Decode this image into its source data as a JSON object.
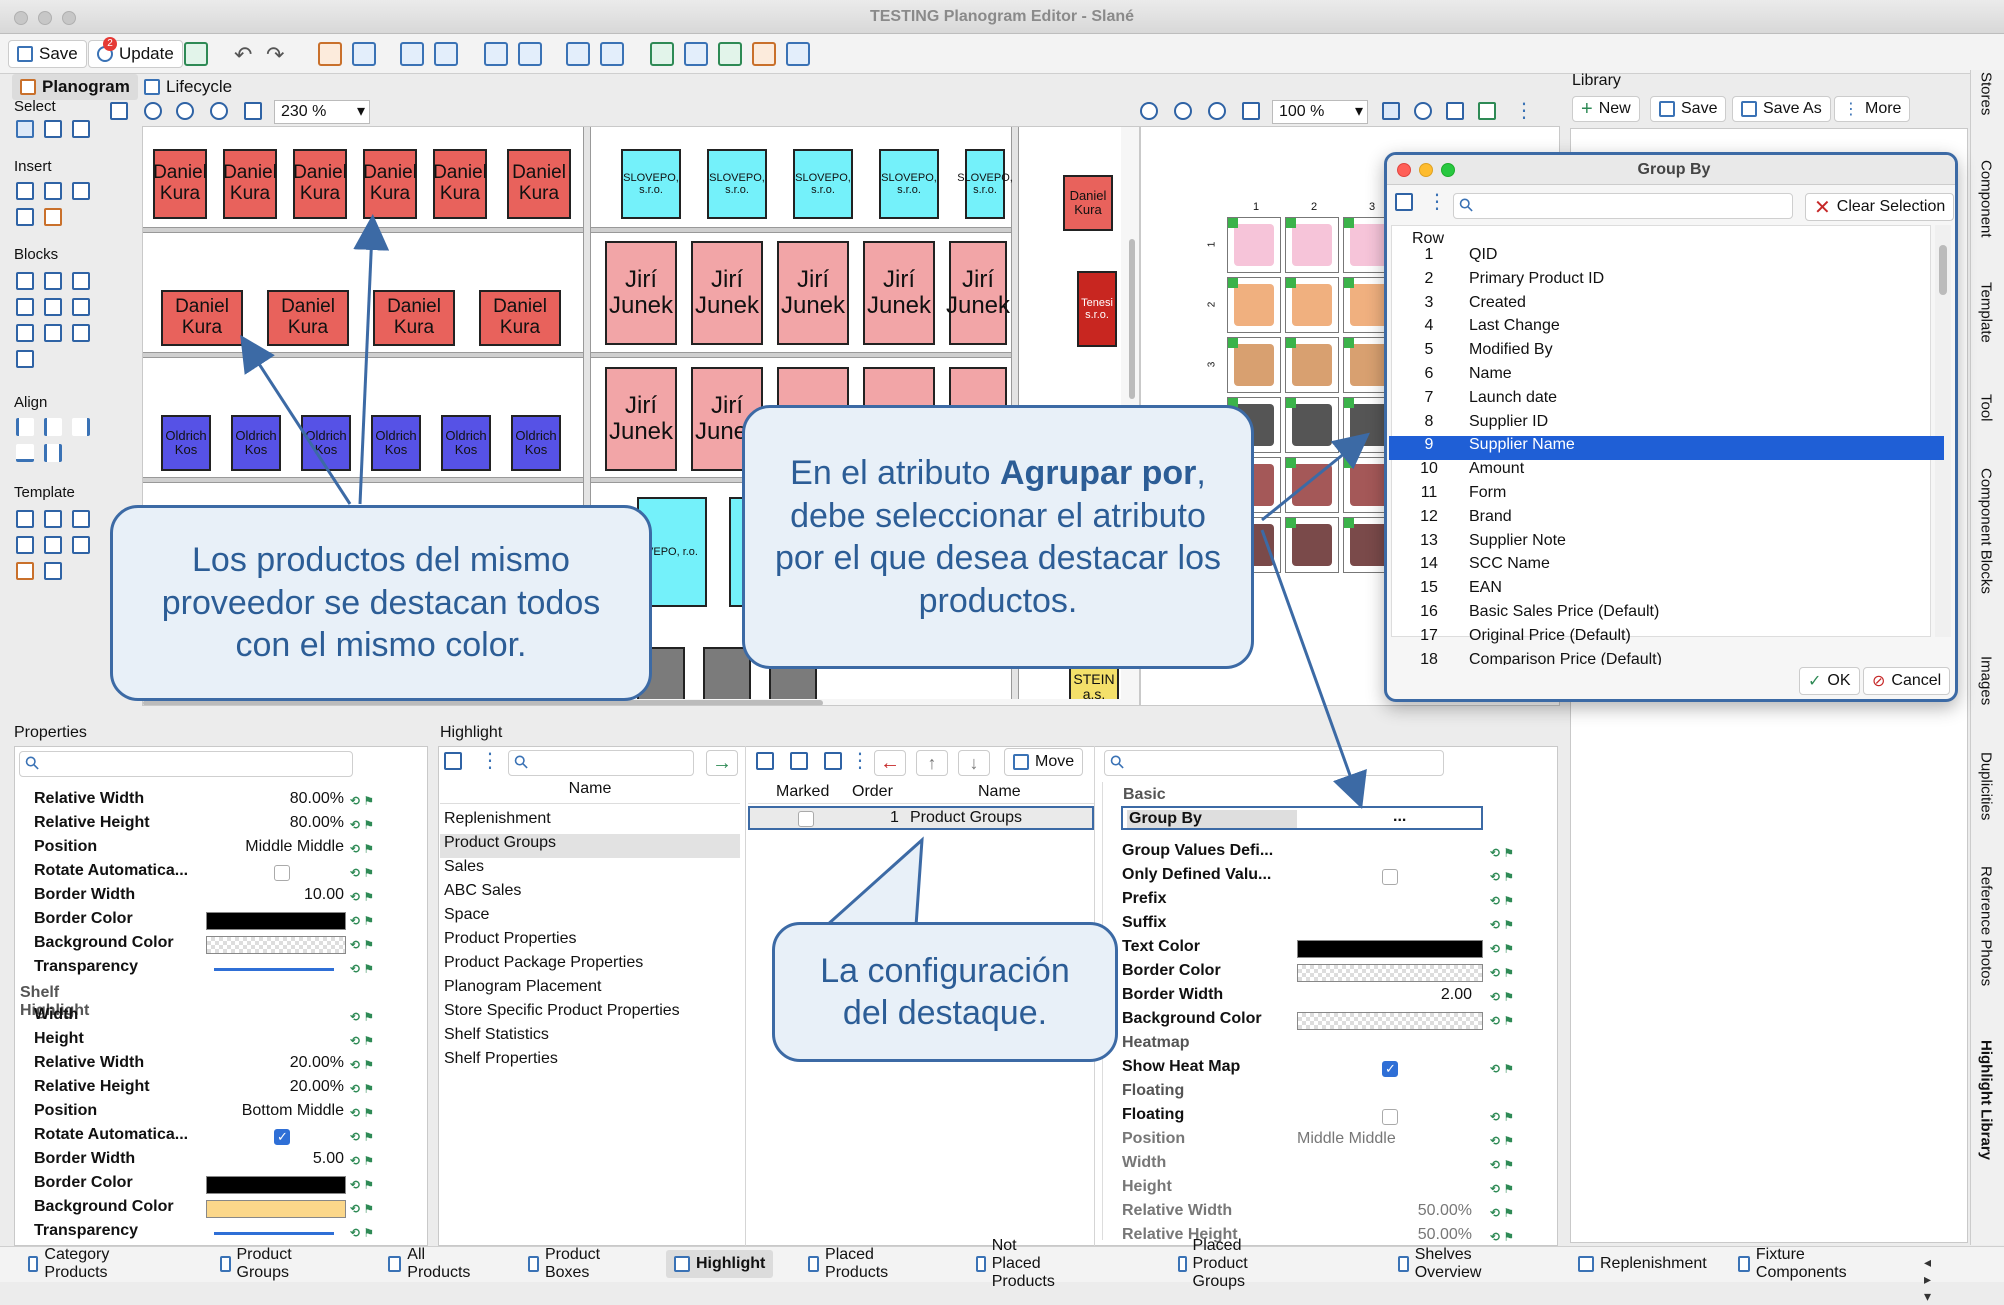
{
  "window": {
    "title": "TESTING Planogram Editor - Slané"
  },
  "toolbar": {
    "save": "Save",
    "update": "Update",
    "update_badge": "2"
  },
  "tabs": {
    "planogram": "Planogram",
    "lifecycle": "Lifecycle"
  },
  "side": {
    "select": "Select",
    "insert": "Insert",
    "blocks": "Blocks",
    "align": "Align",
    "template": "Template"
  },
  "canvas": {
    "zoom_left": "230 %",
    "zoom_right": "100 %"
  },
  "products": {
    "red": "Daniel Kura",
    "blue": "Oldrich Kos",
    "cyan": "SLOVEPO, s.r.o.",
    "pink": "Jirí Junek",
    "tenes": "Tenesi s.r.o.",
    "stein": "STEIN a.s.",
    "vepo": "VEPO, r.o."
  },
  "callouts": {
    "left": "Los productos del mismo proveedor se destacan todos con el mismo color.",
    "mid_pre": "En el atributo ",
    "mid_bold": "Agrupar por",
    "mid_post": ", debe seleccionar el atributo por el que desea destacar los productos.",
    "bottom": "La configuración del destaque."
  },
  "library": {
    "title": "Library",
    "new": "New",
    "save": "Save",
    "save_as": "Save As",
    "more": "More"
  },
  "dialog": {
    "title": "Group By",
    "clear": "Clear Selection",
    "row_header": "Row",
    "ok": "OK",
    "cancel": "Cancel",
    "rows": [
      [
        "1",
        "QID"
      ],
      [
        "2",
        "Primary Product ID"
      ],
      [
        "3",
        "Created"
      ],
      [
        "4",
        "Last Change"
      ],
      [
        "5",
        "Modified By"
      ],
      [
        "6",
        "Name"
      ],
      [
        "7",
        "Launch date"
      ],
      [
        "8",
        "Supplier ID"
      ],
      [
        "9",
        "Supplier Name"
      ],
      [
        "10",
        "Amount"
      ],
      [
        "11",
        "Form"
      ],
      [
        "12",
        "Brand"
      ],
      [
        "13",
        "Supplier Note"
      ],
      [
        "14",
        "SCC Name"
      ],
      [
        "15",
        "EAN"
      ],
      [
        "16",
        "Basic Sales Price (Default)"
      ],
      [
        "17",
        "Original Price (Default)"
      ],
      [
        "18",
        "Comparison Price (Default)"
      ]
    ]
  },
  "properties": {
    "title": "Properties",
    "rows1": [
      [
        "Relative Width",
        "80.00%"
      ],
      [
        "Relative Height",
        "80.00%"
      ],
      [
        "Position",
        "Middle Middle"
      ],
      [
        "Rotate Automatica...",
        ""
      ],
      [
        "Border Width",
        "10.00"
      ],
      [
        "Border Color",
        ""
      ],
      [
        "Background Color",
        ""
      ],
      [
        "Transparency",
        ""
      ]
    ],
    "group": "Shelf Highlight",
    "rows2": [
      [
        "Width",
        ""
      ],
      [
        "Height",
        ""
      ],
      [
        "Relative Width",
        "20.00%"
      ],
      [
        "Relative Height",
        "20.00%"
      ],
      [
        "Position",
        "Bottom Middle"
      ],
      [
        "Rotate Automatica...",
        ""
      ],
      [
        "Border Width",
        "5.00"
      ],
      [
        "Border Color",
        ""
      ],
      [
        "Background Color",
        ""
      ],
      [
        "Transparency",
        ""
      ]
    ]
  },
  "highlight": {
    "title": "Highlight",
    "name_header": "Name",
    "marked_header": "Marked",
    "order_header": "Order",
    "name2_header": "Name",
    "move": "Move",
    "items": [
      "Replenishment",
      "Product Groups",
      "Sales",
      "ABC Sales",
      "Space",
      "Product Properties",
      "Product Package Properties",
      "Planogram Placement",
      "Store Specific Product Properties",
      "Shelf Statistics",
      "Shelf Properties"
    ],
    "row": {
      "order": "1",
      "name": "Product Groups"
    }
  },
  "hprops": {
    "basic": "Basic",
    "group_by": "Group By",
    "group_by_val": "...",
    "gvd": "Group Values Defi...",
    "odv": "Only Defined Valu...",
    "prefix": "Prefix",
    "suffix": "Suffix",
    "text_color": "Text Color",
    "border_color": "Border Color",
    "border_width": "Border Width",
    "border_width_val": "2.00",
    "bg": "Background Color",
    "heatmap": "Heatmap",
    "show_heat": "Show Heat Map",
    "floating_g": "Floating",
    "floating": "Floating",
    "position": "Position",
    "position_val": "Middle Middle",
    "width": "Width",
    "height": "Height",
    "rel_w": "Relative Width",
    "rel_w_val": "50.00%",
    "rel_h": "Relative Height",
    "rel_h_val": "50.00%"
  },
  "bottom_tabs": [
    "Category Products",
    "Product Groups",
    "All Products",
    "Product Boxes",
    "Highlight",
    "Placed Products",
    "Not Placed Products",
    "Placed Product Groups",
    "Shelves Overview",
    "Replenishment",
    "Fixture Components"
  ],
  "right_tabs": [
    "Stores",
    "Component",
    "Template",
    "Tool",
    "Component Blocks",
    "Images",
    "Duplicities",
    "Reference Photos",
    "Highlight Library"
  ],
  "mini_cols": [
    "1",
    "2",
    "3"
  ],
  "mini_rows": [
    "1",
    "2",
    "3"
  ]
}
